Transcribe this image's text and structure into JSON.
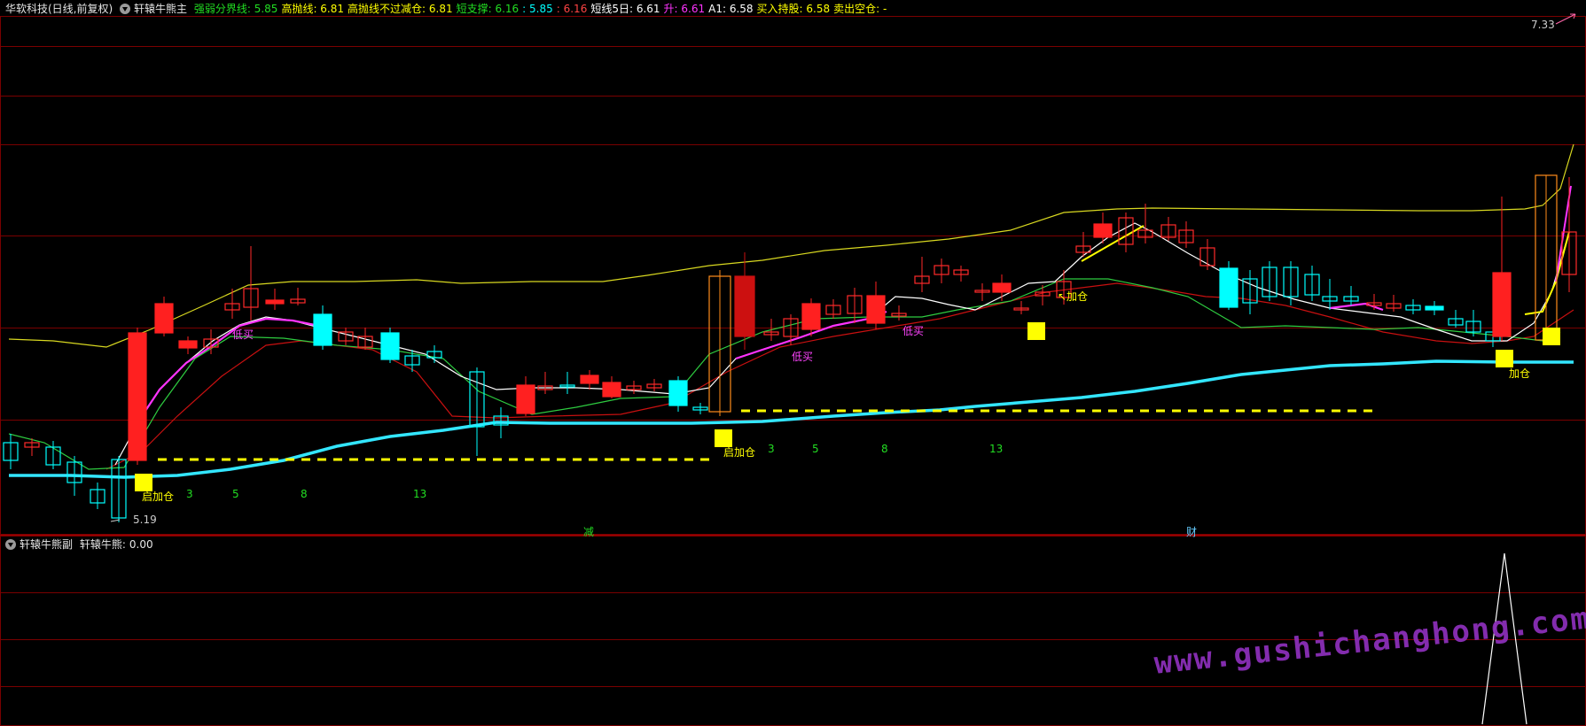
{
  "main": {
    "app_title": "华软科技(日线,前复权)",
    "indicator_name": "轩辕牛熊主",
    "indicators": [
      {
        "label": "强弱分界线:",
        "value": "5.85",
        "color": "#22dd22"
      },
      {
        "label": "高抛线:",
        "value": "6.81",
        "color": "#ffff00"
      },
      {
        "label": "高抛线不过减仓:",
        "value": "6.81",
        "color": "#ffff00"
      },
      {
        "label": "短支撑:",
        "value": "6.16",
        "color": "#22dd22"
      },
      {
        "label": ":",
        "value": "5.85",
        "color": "#00ffff"
      },
      {
        "label": ":",
        "value": "6.16",
        "color": "#ff4444"
      },
      {
        "label": "短线5日:",
        "value": "6.61",
        "color": "#ffffff"
      },
      {
        "label": "升:",
        "value": "6.61",
        "color": "#ff33ff"
      },
      {
        "label": "A1:",
        "value": "6.58",
        "color": "#ffffff"
      },
      {
        "label": "买入持股:",
        "value": "6.58",
        "color": "#ffff00"
      },
      {
        "label": "卖出空仓:",
        "value": "-",
        "color": "#ffff00"
      }
    ],
    "price_high": "7.33",
    "price_low": "5.19",
    "signals": {
      "buy_add": "加仓",
      "start_add": "启加仓",
      "low_buy": "低买",
      "reduce": "减",
      "wealth": "财"
    },
    "cycle_numbers": [
      "3",
      "5",
      "8",
      "13"
    ]
  },
  "sub": {
    "indicator_name": "轩辕牛熊副",
    "value_label": "轩辕牛熊:",
    "value": "0.00"
  },
  "watermark": "www.gushichanghong.com",
  "colors": {
    "up": "#ff2020",
    "down": "#00ffff",
    "grid": "#7a0000",
    "support": "#33e6ff"
  }
}
